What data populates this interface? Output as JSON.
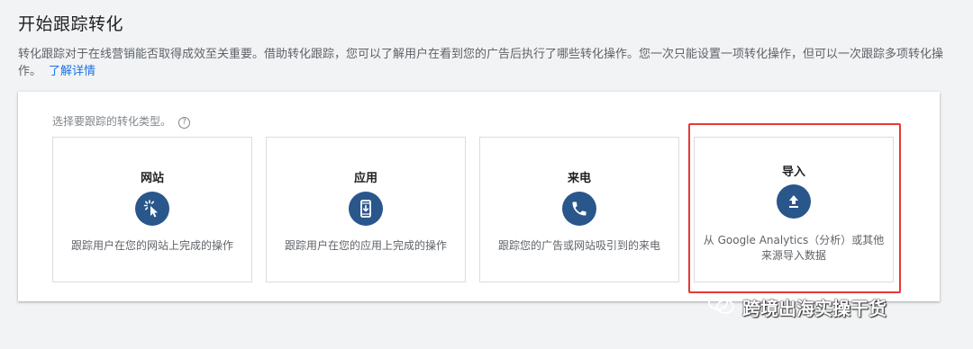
{
  "header": {
    "title": "开始跟踪转化",
    "description": "转化跟踪对于在线营销能否取得成效至关重要。借助转化跟踪，您可以了解用户在看到您的广告后执行了哪些转化操作。您一次只能设置一项转化操作，但可以一次跟踪多项转化操作。",
    "learn_more": "了解详情"
  },
  "panel": {
    "prompt": "选择要跟踪的转化类型。",
    "help_icon": "?",
    "cards": [
      {
        "title": "网站",
        "icon": "cursor-click-icon",
        "description": "跟踪用户在您的网站上完成的操作"
      },
      {
        "title": "应用",
        "icon": "mobile-app-icon",
        "description": "跟踪用户在您的应用上完成的操作"
      },
      {
        "title": "来电",
        "icon": "phone-icon",
        "description": "跟踪您的广告或网站吸引到的来电"
      },
      {
        "title": "导入",
        "icon": "upload-icon",
        "description": "从 Google Analytics（分析）或其他来源导入数据"
      }
    ]
  },
  "accent_colors": {
    "icon_bg": "#29568b",
    "link": "#1a73e8",
    "highlight": "#e53935"
  },
  "watermark": {
    "text": "跨境出海实操干货",
    "icon": "wechat-logo-icon"
  }
}
